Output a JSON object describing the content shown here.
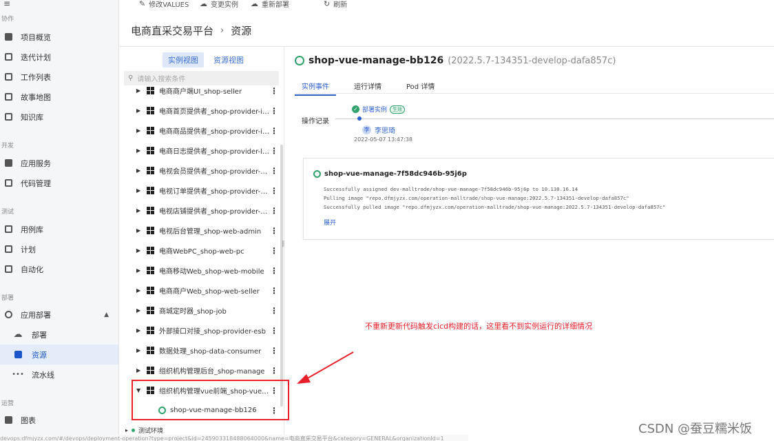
{
  "sidebar": {
    "sections": {
      "collab": "协作",
      "dev": "开发",
      "test": "测试",
      "deploy": "部署",
      "ops": "运营"
    },
    "items": [
      {
        "label": "项目概览",
        "icon": "overview-icon"
      },
      {
        "label": "迭代计划",
        "icon": "iteration-icon"
      },
      {
        "label": "工作列表",
        "icon": "worklist-icon"
      },
      {
        "label": "故事地图",
        "icon": "map-icon"
      },
      {
        "label": "知识库",
        "icon": "knowledge-icon"
      },
      {
        "label": "应用服务",
        "icon": "apps-icon"
      },
      {
        "label": "代码管理",
        "icon": "code-icon"
      },
      {
        "label": "用例库",
        "icon": "testcase-icon"
      },
      {
        "label": "计划",
        "icon": "calendar-icon"
      },
      {
        "label": "自动化",
        "icon": "automation-icon"
      },
      {
        "label": "应用部署",
        "icon": "deploy-icon"
      },
      {
        "label": "部署",
        "icon": "cloud-upload-icon"
      },
      {
        "label": "资源",
        "icon": "resource-icon"
      },
      {
        "label": "流水线",
        "icon": "pipeline-icon"
      },
      {
        "label": "图表",
        "icon": "chart-icon"
      }
    ]
  },
  "toolbar": {
    "edit_values": "修改VALUES",
    "change_instance": "变更实例",
    "redeploy": "重新部署",
    "refresh": "刷新"
  },
  "breadcrumb": {
    "project": "电商直采交易平台",
    "page": "资源"
  },
  "resource_panel": {
    "tab_instance": "实例视图",
    "tab_resource": "资源视图",
    "search_placeholder": "请输入搜索条件",
    "tree": [
      "电商商户端UI_shop-seller",
      "电商首页提供者_shop-provider-index",
      "电商商品提供者_shop-provider-item",
      "电商日志提供者_shop-provider-log",
      "电视会员提供者_shop-provider-me...",
      "电视订单提供者_shop-provider-order",
      "电视店铺提供者_shop-provider-shop",
      "电视后台管理_shop-web-admin",
      "电商WebPC_shop-web-pc",
      "电商移动Web_shop-web-mobile",
      "电商商户Web_shop-web-seller",
      "商城定时器_shop-job",
      "外部接口对接_shop-provider-esb",
      "数据处理_shop-data-consumer",
      "组织机构管理后台_shop-manage",
      "组织机构管理vue前端_shop-vue-ma..."
    ],
    "child_instance": "shop-vue-manage-bb126",
    "env": "测试环境"
  },
  "detail": {
    "instance_name": "shop-vue-manage-bb126",
    "version": "(2022.5.7-134351-develop-dafa857c)",
    "tabs": [
      "实例事件",
      "运行详情",
      "Pod 详情"
    ],
    "op_label": "操作记录",
    "event_label": "部署实例",
    "event_badge": "生效",
    "user_initial": "李",
    "user_name": "李思琦",
    "event_time": "2022-05-07 13:47:38",
    "pod_name": "shop-vue-manage-7f58dc946b-95j6p",
    "logs": [
      "Successfully assigned dev-malltrade/shop-vue-manage-7f58dc946b-95j6p to 10.130.16.14",
      "Pulling image \"repo.dfmjyzx.com/operation-malltrade/shop-vue-manage:2022.5.7-134351-develop-dafa857c\"",
      "Successfully pulled image \"repo.dfmjyzx.com/operation-malltrade/shop-vue-manage:2022.5.7-134351-develop-dafa857c\""
    ],
    "expand": "展开"
  },
  "annotation": "不重新更新代码触发cicd构建的话，这里看不到实例运行的详细情况",
  "status_url": "devops.dfmjyzx.com/#/devops/deployment-operation?type=project&id=245903318488064000&name=电商直采交易平台&category=GENERAL&organizationId=1",
  "watermark": "CSDN @蚕豆糯米饭",
  "colors": {
    "accent": "#2d5fcf",
    "success": "#2fa36b",
    "annotation": "#e8202a"
  }
}
